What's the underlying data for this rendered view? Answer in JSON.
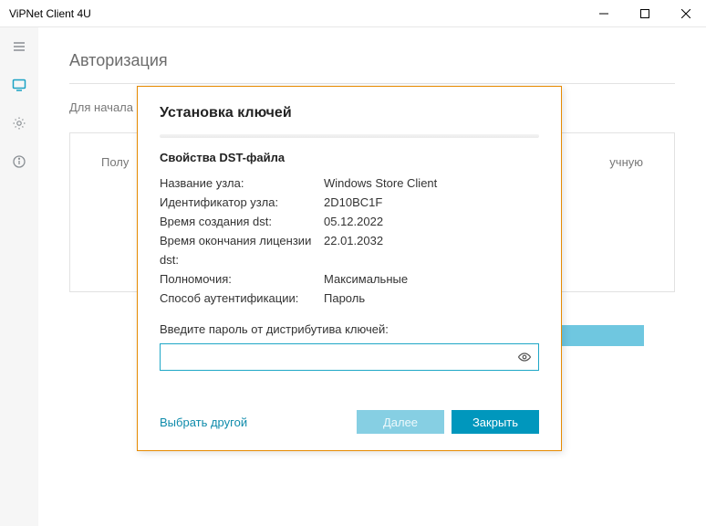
{
  "window": {
    "title": "ViPNet Client 4U"
  },
  "page": {
    "title": "Авторизация",
    "hint": "Для начала",
    "card_left": "Полу",
    "card_right": "учную"
  },
  "modal": {
    "title": "Установка ключей",
    "section": "Свойства DST-файла",
    "rows": [
      {
        "k": "Название узла:",
        "v": "Windows Store Client"
      },
      {
        "k": "Идентификатор узла:",
        "v": "2D10BC1F"
      },
      {
        "k": "Время создания dst:",
        "v": "05.12.2022"
      },
      {
        "k": "Время окончания лицензии dst:",
        "v": "22.01.2032"
      },
      {
        "k": "Полномочия:",
        "v": "Максимальные"
      },
      {
        "k": "Способ аутентификации:",
        "v": "Пароль"
      }
    ],
    "prompt": "Введите пароль от дистрибутива ключей:",
    "password_value": "",
    "choose_other": "Выбрать другой",
    "next": "Далее",
    "close": "Закрыть"
  }
}
